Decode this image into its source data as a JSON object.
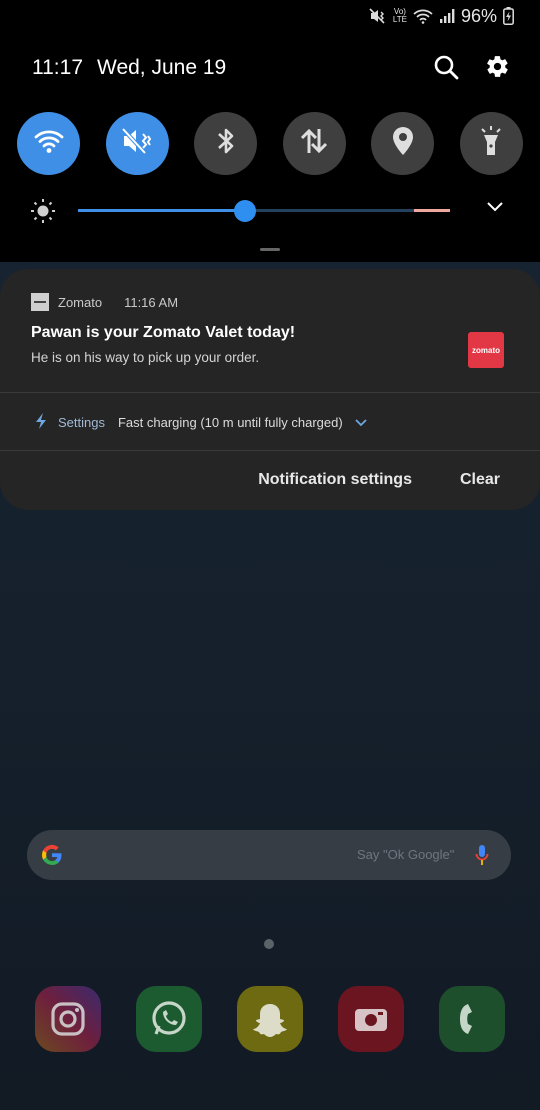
{
  "status_bar": {
    "icons": [
      "mute-vibrate-icon",
      "volte-icon",
      "wifi-icon",
      "signal-icon"
    ],
    "volte_label": "Vo)\nLTE",
    "battery_percent": "96%",
    "battery_icon": "battery-charging-icon"
  },
  "header": {
    "time": "11:17",
    "date": "Wed, June 19",
    "search_icon": "search-icon",
    "settings_icon": "gear-icon"
  },
  "quick_toggles": [
    {
      "name": "wifi",
      "icon": "wifi-icon",
      "on": true
    },
    {
      "name": "sound-mode",
      "icon": "mute-vibrate-icon",
      "on": true
    },
    {
      "name": "bluetooth",
      "icon": "bluetooth-icon",
      "on": false
    },
    {
      "name": "mobile-data",
      "icon": "data-arrows-icon",
      "on": false
    },
    {
      "name": "location",
      "icon": "location-icon",
      "on": false
    },
    {
      "name": "flashlight",
      "icon": "flashlight-icon",
      "on": false
    }
  ],
  "brightness": {
    "level": 0.45,
    "expand_icon": "chevron-down-icon"
  },
  "notification": {
    "app_name": "Zomato",
    "time": "11:16 AM",
    "title": "Pawan is your Zomato Valet today!",
    "text": "He is on his way to pick up your order.",
    "thumbnail_text": "zomato"
  },
  "charging": {
    "label": "Settings",
    "message": "Fast charging (10 m until fully charged)"
  },
  "actions": {
    "notification_settings": "Notification settings",
    "clear": "Clear"
  },
  "google_bar": {
    "placeholder": "Say \"Ok Google\""
  },
  "dock": [
    "instagram-icon",
    "whatsapp-icon",
    "snapchat-icon",
    "camera-app-icon",
    "phone-icon"
  ],
  "colors": {
    "accent": "#3f8fe6",
    "zomato": "#e23744",
    "panel": "#252525"
  }
}
